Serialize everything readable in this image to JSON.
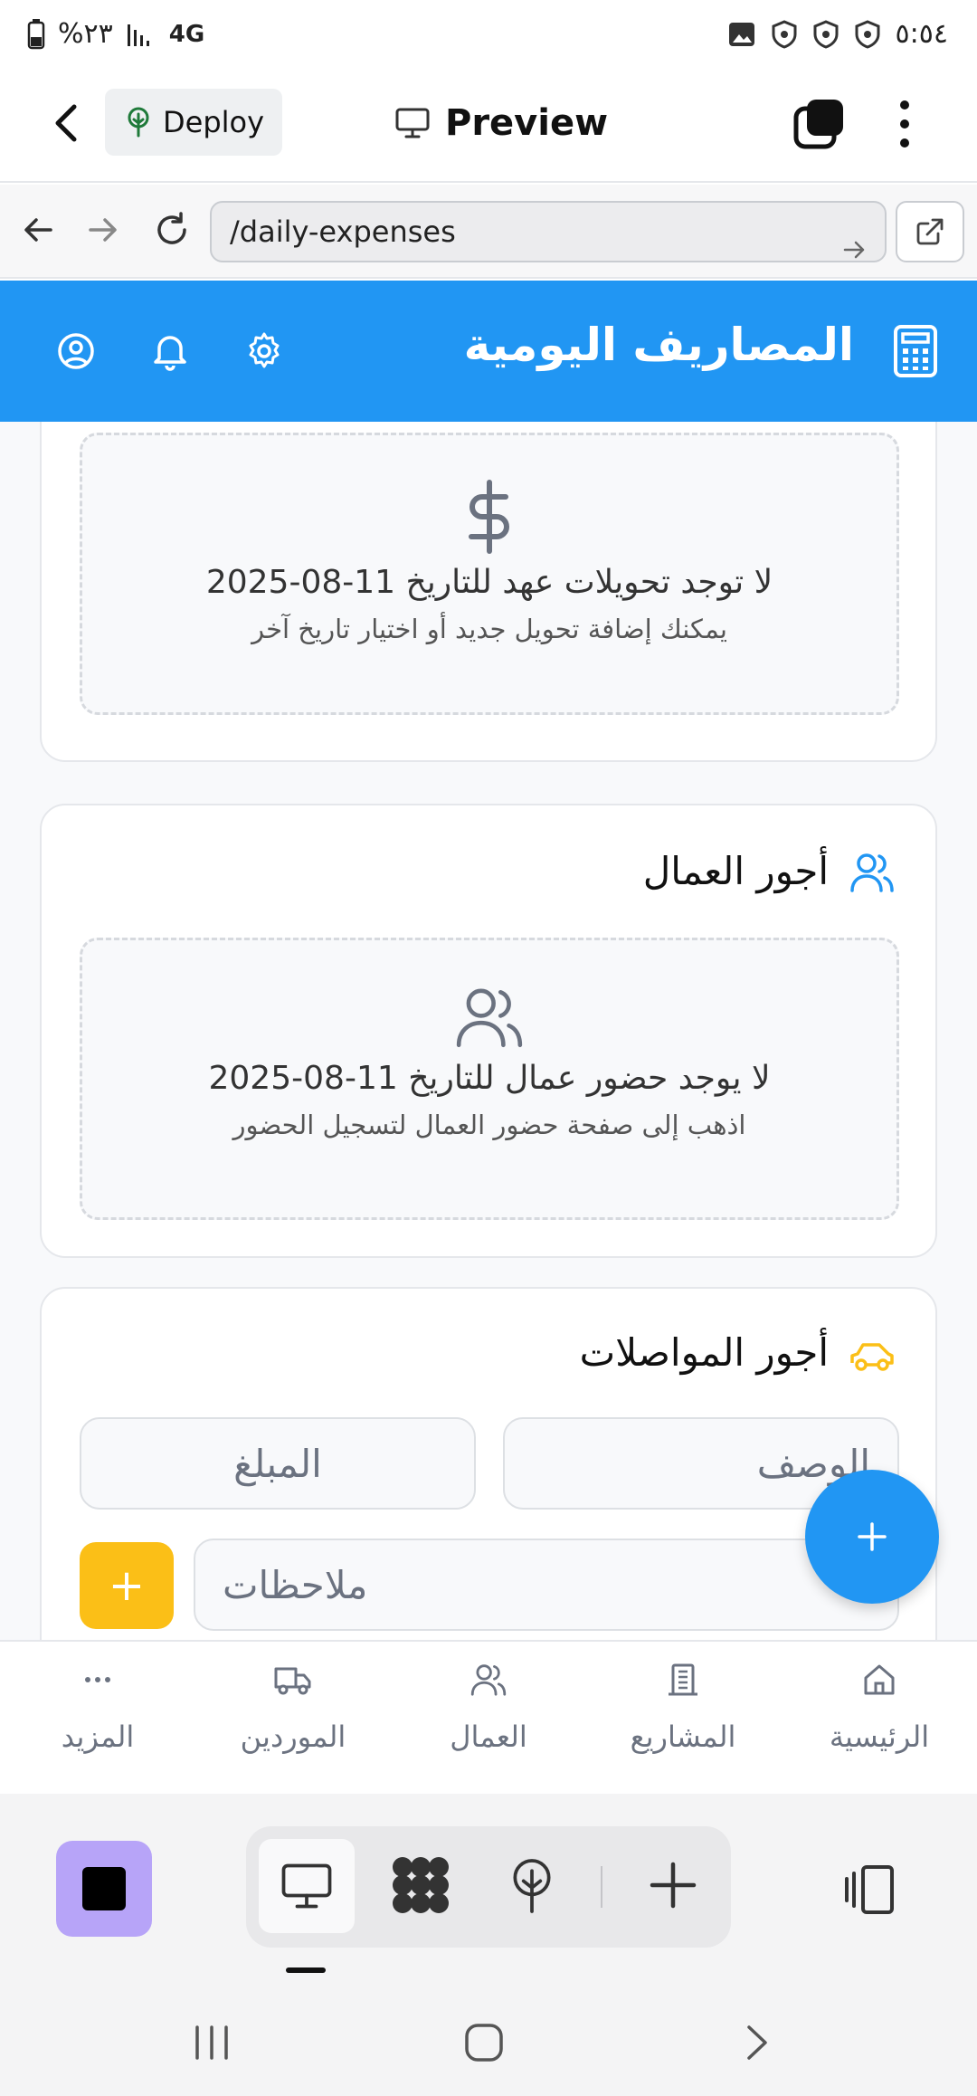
{
  "status_bar": {
    "battery": "%٢٣",
    "network": "4G",
    "time": "٥:٥٤"
  },
  "app_header": {
    "deploy_label": "Deploy",
    "preview_label": "Preview"
  },
  "url_bar": {
    "url": "/daily-expenses"
  },
  "page_header": {
    "title": "المصاريف اليومية"
  },
  "transfers_section": {
    "empty_title": "لا توجد تحويلات عهد للتاريخ 11-08-2025",
    "empty_subtitle": "يمكنك إضافة تحويل جديد أو اختيار تاريخ آخر"
  },
  "workers_section": {
    "title": "أجور العمال",
    "empty_title": "لا يوجد حضور عمال للتاريخ 11-08-2025",
    "empty_subtitle": "اذهب إلى صفحة حضور العمال لتسجيل الحضور"
  },
  "transport_section": {
    "title": "أجور المواصلات",
    "description_placeholder": "الوصف",
    "amount_placeholder": "المبلغ",
    "notes_placeholder": "ملاحظات",
    "add_label": "+"
  },
  "bottom_nav": {
    "items": [
      {
        "label": "الرئيسية",
        "icon": "home-icon"
      },
      {
        "label": "المشاريع",
        "icon": "building-icon"
      },
      {
        "label": "العمال",
        "icon": "users-icon"
      },
      {
        "label": "الموردين",
        "icon": "truck-icon"
      },
      {
        "label": "المزيد",
        "icon": "more-icon"
      }
    ]
  },
  "colors": {
    "primary": "#2196f3",
    "accent_yellow": "#fbbf17",
    "stop_button": "#b7a4f8"
  }
}
